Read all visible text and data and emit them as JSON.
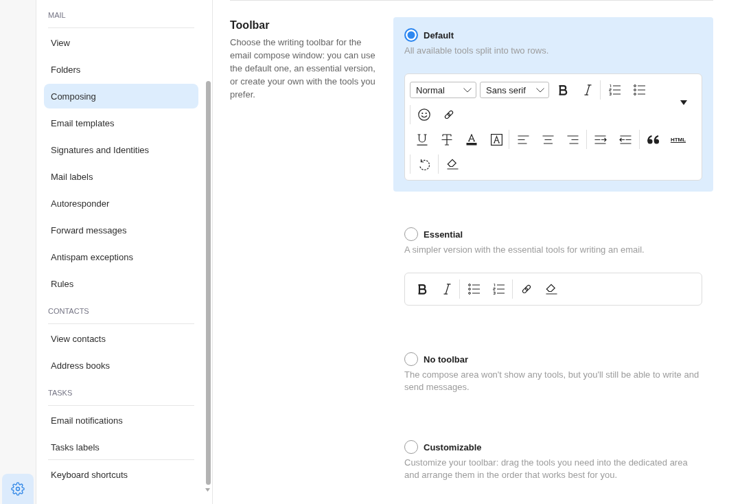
{
  "rail": {
    "settings_button": {
      "selected": true
    }
  },
  "sidebar": {
    "sections": [
      {
        "title": "MAIL",
        "items": [
          {
            "label": "View",
            "selected": false
          },
          {
            "label": "Folders",
            "selected": false
          },
          {
            "label": "Composing",
            "selected": true
          },
          {
            "label": "Email templates",
            "selected": false
          },
          {
            "label": "Signatures and Identities",
            "selected": false
          },
          {
            "label": "Mail labels",
            "selected": false
          },
          {
            "label": "Autoresponder",
            "selected": false
          },
          {
            "label": "Forward messages",
            "selected": false
          },
          {
            "label": "Antispam exceptions",
            "selected": false
          },
          {
            "label": "Rules",
            "selected": false
          }
        ]
      },
      {
        "title": "CONTACTS",
        "items": [
          {
            "label": "View contacts",
            "selected": false
          },
          {
            "label": "Address books",
            "selected": false
          }
        ]
      },
      {
        "title": "TASKS",
        "items": [
          {
            "label": "Email notifications",
            "selected": false
          },
          {
            "label": "Tasks labels",
            "selected": false
          }
        ]
      },
      {
        "items": [
          {
            "label": "Keyboard shortcuts",
            "selected": false
          }
        ]
      }
    ]
  },
  "main": {
    "setting": {
      "title": "Toolbar",
      "description": "Choose the writing toolbar for the email compose window: you can use the default one, an essential version, or create your own with the tools you prefer."
    },
    "options": [
      {
        "label": "Default",
        "description": "All available tools split into two rows.",
        "selected": true,
        "toolbar": {
          "rows": [
            {
              "expand_toggle": true,
              "groups": [
                [
                  {
                    "kind": "heading",
                    "value": "Normal"
                  },
                  {
                    "kind": "font",
                    "value": "Sans serif"
                  },
                  {
                    "kind": "bold"
                  },
                  {
                    "kind": "italic"
                  }
                ],
                [
                  {
                    "kind": "numbered"
                  },
                  {
                    "kind": "bulleted"
                  }
                ],
                [
                  {
                    "kind": "emoji"
                  },
                  {
                    "kind": "link"
                  }
                ]
              ]
            },
            {
              "groups": [
                [
                  {
                    "kind": "underline"
                  },
                  {
                    "kind": "strike"
                  },
                  {
                    "kind": "color"
                  },
                  {
                    "kind": "background"
                  }
                ],
                [
                  {
                    "kind": "alignleft"
                  },
                  {
                    "kind": "aligncenter"
                  },
                  {
                    "kind": "alignright"
                  }
                ],
                [
                  {
                    "kind": "indent"
                  },
                  {
                    "kind": "outdent"
                  }
                ],
                [
                  {
                    "kind": "quote"
                  },
                  {
                    "kind": "html",
                    "label": "HTML"
                  }
                ],
                [
                  {
                    "kind": "undo"
                  }
                ],
                [
                  {
                    "kind": "clean"
                  }
                ]
              ]
            }
          ]
        }
      },
      {
        "label": "Essential",
        "description": "A simpler version with the essential tools for writing an email.",
        "selected": false,
        "toolbar": {
          "rows": [
            {
              "groups": [
                [
                  {
                    "kind": "bold"
                  },
                  {
                    "kind": "italic"
                  }
                ],
                [
                  {
                    "kind": "bulleted"
                  },
                  {
                    "kind": "numbered"
                  }
                ],
                [
                  {
                    "kind": "link"
                  },
                  {
                    "kind": "clean"
                  }
                ]
              ]
            }
          ]
        }
      },
      {
        "label": "No toolbar",
        "description": "The compose area won't show any tools, but you'll still be able to write and send messages.",
        "selected": false
      },
      {
        "label": "Customizable",
        "description": "Customize your toolbar: drag the tools you need into the dedicated area and arrange them in the order that works best for you.",
        "selected": false
      }
    ]
  }
}
